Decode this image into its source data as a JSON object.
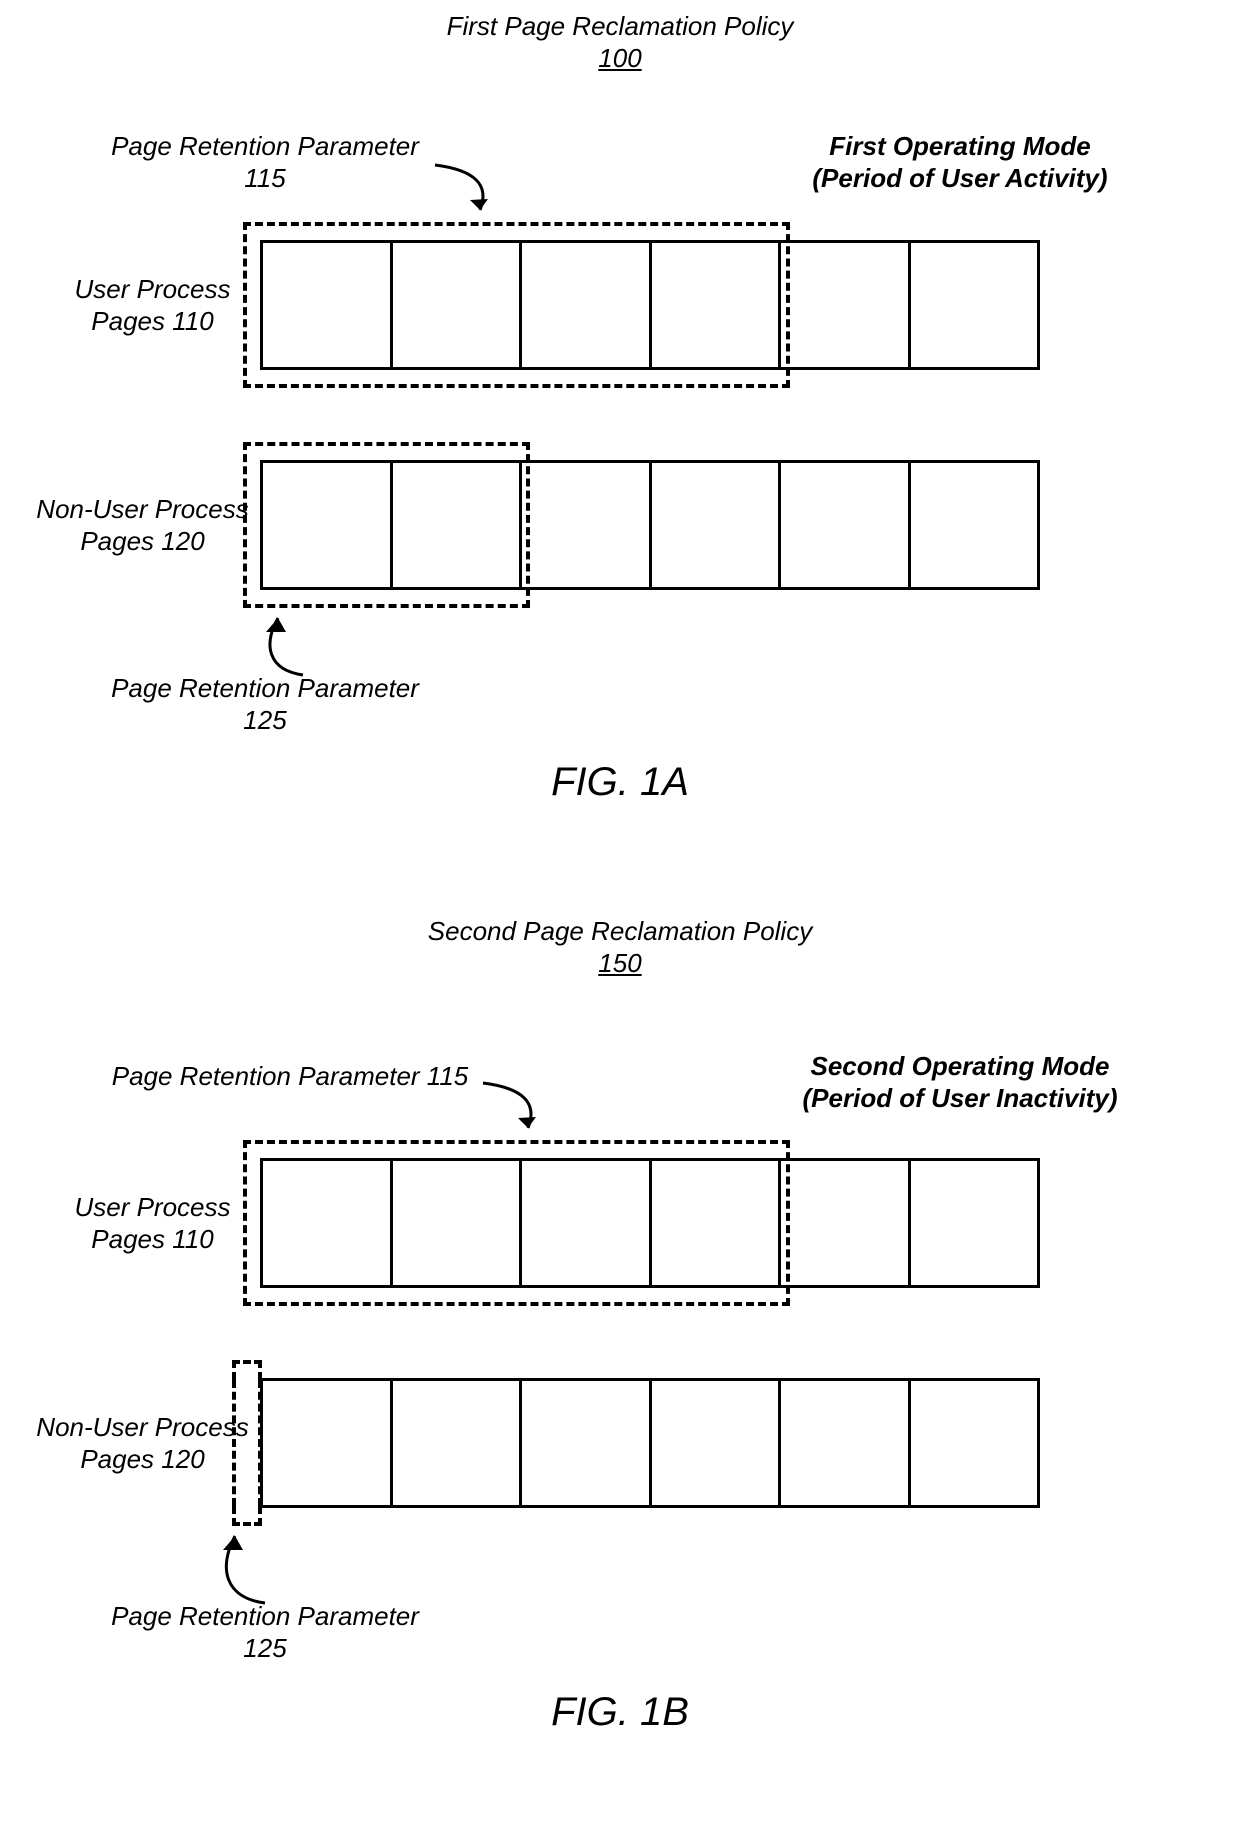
{
  "figA": {
    "title": "First Page Reclamation Policy",
    "titleNum": "100",
    "operatingMode": "First Operating Mode",
    "operatingModeSub": "(Period of User Activity)",
    "userLabel1": "User Process",
    "userLabel2": "Pages 110",
    "nonUserLabel1": "Non-User Process",
    "nonUserLabel2": "Pages 120",
    "paramTopLabel1": "Page Retention Parameter",
    "paramTopLabel2": "115",
    "paramBotLabel1": "Page Retention Parameter",
    "paramBotLabel2": "125",
    "caption": "FIG. 1A"
  },
  "figB": {
    "title": "Second Page Reclamation Policy",
    "titleNum": "150",
    "operatingMode": "Second Operating Mode",
    "operatingModeSub": "(Period of User Inactivity)",
    "userLabel1": "User Process",
    "userLabel2": "Pages 110",
    "nonUserLabel1": "Non-User Process",
    "nonUserLabel2": "Pages 120",
    "paramTopLabel": "Page Retention Parameter 115",
    "paramBotLabel1": "Page Retention Parameter",
    "paramBotLabel2": "125",
    "caption": "FIG. 1B"
  }
}
